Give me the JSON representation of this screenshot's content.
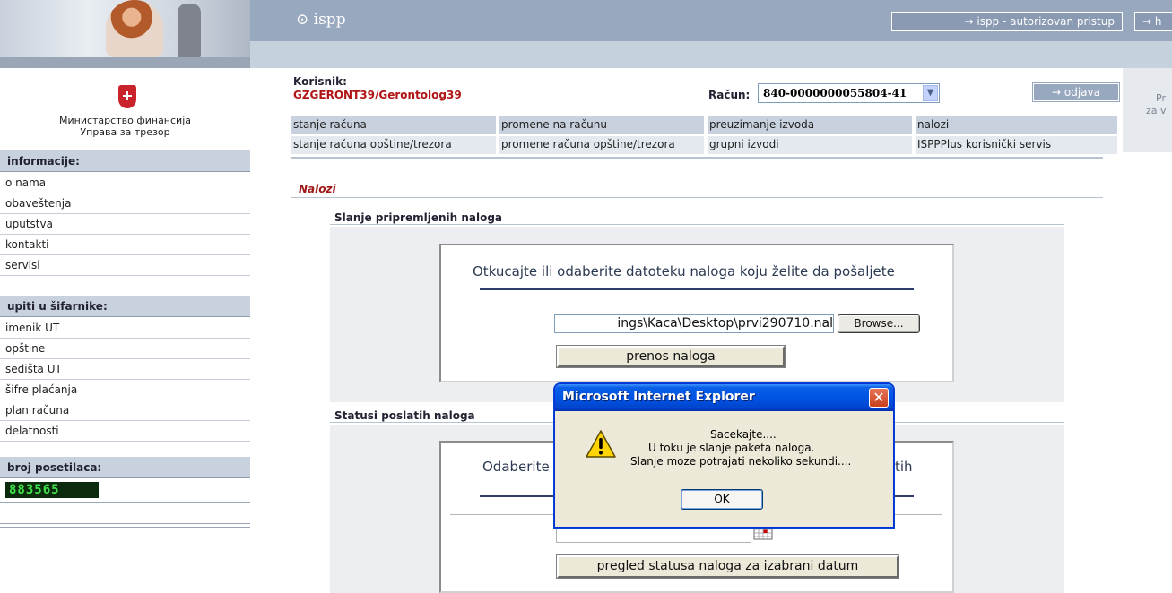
{
  "header": {
    "app_title": "⊙ ispp",
    "auth_link": "→ ispp - autorizovan pristup",
    "help_link": "→ h",
    "right_panel_text_1": "Pr",
    "right_panel_text_2": "za v"
  },
  "sidebar": {
    "ministry_line_1": "Министарство финансија",
    "ministry_line_2": "Управа за трезор",
    "info_heading": "informacije:",
    "info_items": [
      "o nama",
      "obaveštenja",
      "uputstva",
      "kontakti",
      "servisi"
    ],
    "lookup_heading": "upiti u šifarnike:",
    "lookup_items": [
      "imenik UT",
      "opštine",
      "sedišta UT",
      "šifre plaćanja",
      "plan računa",
      "delatnosti"
    ],
    "visitors_heading": "broj posetilaca:",
    "visitor_count": "883565"
  },
  "user": {
    "label": "Korisnik:",
    "value": "GZGERONT39/Gerontolog39"
  },
  "account": {
    "label": "Račun:",
    "selected": "840-0000000055804-41"
  },
  "logout_label": "→ odjava",
  "nav": {
    "row1": [
      "stanje računa",
      "promene na računu",
      "preuzimanje izvoda",
      "nalozi"
    ],
    "row2": [
      "stanje računa opštine/trezora",
      "promene računa opštine/trezora",
      "grupni izvodi",
      "ISPPPlus korisnički servis"
    ]
  },
  "page": {
    "section_title": "Nalozi",
    "upload": {
      "heading": "Slanje pripremljenih naloga",
      "instruction": "Otkucajte ili odaberite datoteku naloga koju želite da pošaljete",
      "file_value": "ings\\Kaca\\Desktop\\prvi290710.nal",
      "browse_label": "Browse...",
      "submit_label": "prenos naloga"
    },
    "status": {
      "heading": "Statusi poslatih naloga",
      "instruction_left": "Odaberite",
      "instruction_right": "tih",
      "date_value": "",
      "submit_label": "pregled statusa naloga za izabrani datum"
    }
  },
  "dialog": {
    "title": "Microsoft Internet Explorer",
    "close_glyph": "✕",
    "line1": "Sacekajte....",
    "line2": "U toku je slanje paketa naloga.",
    "line3": "Slanje moze potrajati nekoliko sekundi....",
    "ok_label": "OK"
  },
  "colors": {
    "banner": "#98a8bf",
    "user_value": "#b01515",
    "section_title": "#a01717",
    "dialog_title_bar": "#0054e3",
    "counter_digits": "#3fe14a"
  },
  "icons": {
    "dialog_icon": "warning-icon",
    "date_picker": "calendar-icon",
    "logo": "coat-of-arms-icon"
  }
}
